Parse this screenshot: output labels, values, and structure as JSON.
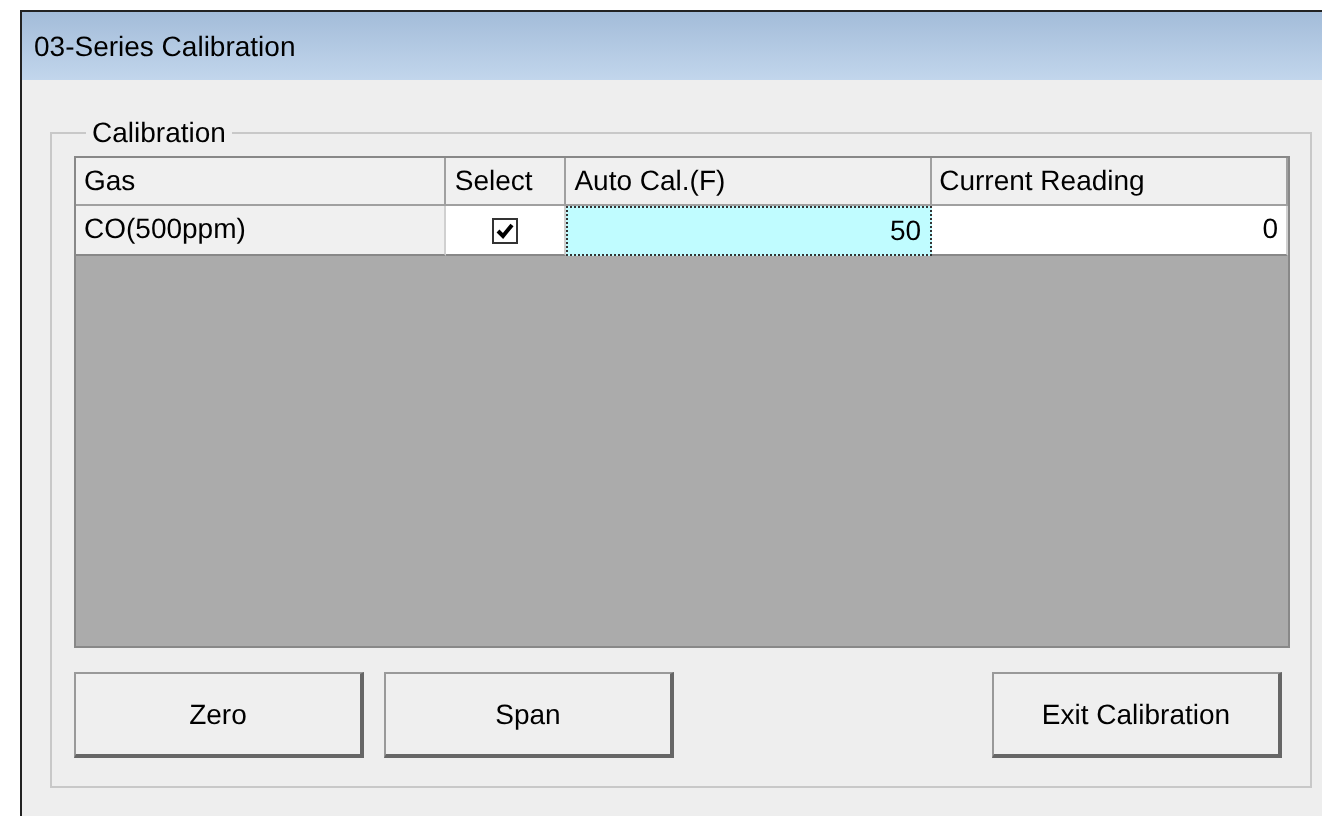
{
  "window": {
    "title": "03-Series Calibration"
  },
  "group": {
    "title": "Calibration"
  },
  "table": {
    "columns": [
      "Gas",
      "Select",
      "Auto Cal.(F)",
      "Current Reading"
    ],
    "rows": [
      {
        "gas": "CO(500ppm)",
        "checked": true,
        "auto_cal": "50",
        "auto_cal_selected": true,
        "current_reading": "0"
      }
    ]
  },
  "buttons": [
    "Zero",
    "Span",
    "Exit Calibration"
  ]
}
